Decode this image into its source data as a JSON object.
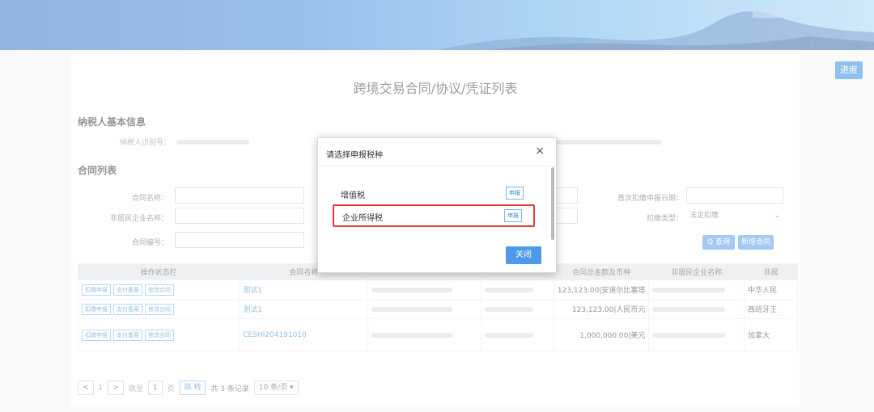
{
  "header": {
    "progress_button": "进度"
  },
  "page": {
    "title": "跨境交易合同/协议/凭证列表"
  },
  "taxpayer": {
    "section_title": "纳税人基本信息",
    "id_label": "纳税人识别号："
  },
  "contracts": {
    "section_title": "合同列表",
    "form": {
      "contract_name_label": "合同名称：",
      "nonresident_name_label": "非居民企业名称：",
      "contract_no_label": "合同编号：",
      "first_withholding_date_label": "首次扣缴申报日期：",
      "withholding_type_label": "扣缴类型：",
      "withholding_type_value": "法定扣缴",
      "query_button": "Q 查询",
      "add_button": "新增合同"
    },
    "table": {
      "headers": [
        "操作状态栏",
        "合同名称",
        "",
        "",
        "合同总金额及币种",
        "非居民企业名称",
        "非居"
      ],
      "op_buttons": [
        "扣缴申报",
        "支付备案",
        "修改合同"
      ],
      "rows": [
        {
          "name": "测试1",
          "amount": "123,123.00|安道尔比塞塔",
          "company": "中华人民"
        },
        {
          "name": "测试1",
          "amount": "123,123.00|人民币元",
          "company": "西班牙王"
        },
        {
          "name": "CESHI204191010",
          "amount": "1,000,000.00|美元",
          "company": "加拿大"
        }
      ]
    },
    "pager": {
      "prev": "<",
      "current_page": "1",
      "next": ">",
      "goto_label": "跳至",
      "goto_value": "1",
      "page_unit": "页",
      "jump_button": "跳 转",
      "total": "共 3 条记录",
      "page_size": "10 条/页"
    }
  },
  "dialog": {
    "title": "请选择申报税种",
    "close": "×",
    "items": [
      {
        "name": "增值税",
        "button": "申报"
      },
      {
        "name": "企业所得税",
        "button": "申报"
      }
    ],
    "ok_button": "关闭"
  },
  "colors": {
    "accent": "#2d87e0",
    "highlight": "#e53a3a"
  }
}
